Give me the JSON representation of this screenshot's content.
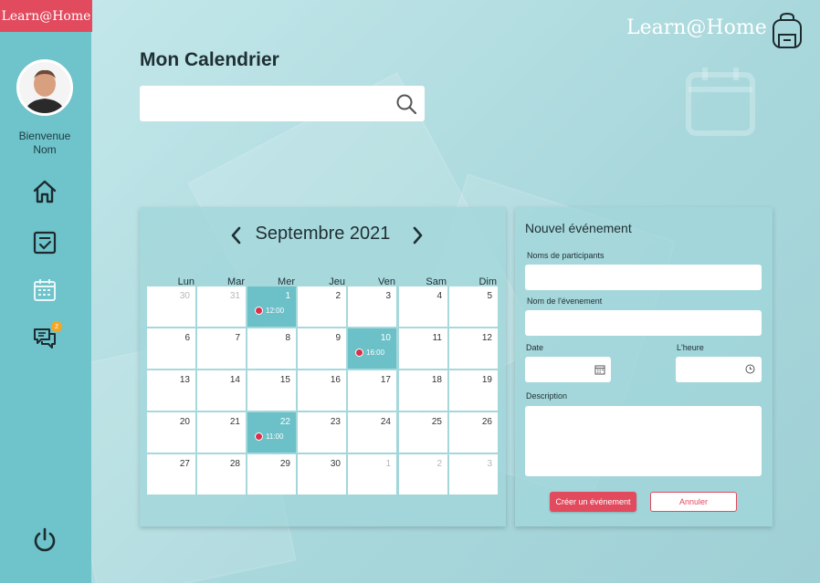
{
  "brand": {
    "badge_label": "Learn@Home",
    "header_logo_text": "Learn@Home"
  },
  "sidebar": {
    "welcome_line1": "Bienvenue",
    "welcome_line2": "Nom",
    "items": [
      {
        "icon": "home-icon"
      },
      {
        "icon": "tasks-icon"
      },
      {
        "icon": "calendar-icon",
        "active": true
      },
      {
        "icon": "chat-icon",
        "badge": "2"
      }
    ],
    "logout_icon": "power-icon"
  },
  "page": {
    "title": "Mon Calendrier",
    "search": {
      "value": "",
      "placeholder": ""
    }
  },
  "calendar": {
    "month_label": "Septembre 2021",
    "weekdays": [
      "Lun",
      "Mar",
      "Mer",
      "Jeu",
      "Ven",
      "Sam",
      "Dim"
    ],
    "weeks": [
      [
        {
          "d": "30",
          "m": true
        },
        {
          "d": "31",
          "m": true
        },
        {
          "d": "1",
          "e": "12:00"
        },
        {
          "d": "2"
        },
        {
          "d": "3"
        },
        {
          "d": "4"
        },
        {
          "d": "5"
        }
      ],
      [
        {
          "d": "6"
        },
        {
          "d": "7"
        },
        {
          "d": "8"
        },
        {
          "d": "9"
        },
        {
          "d": "10",
          "e": "16:00"
        },
        {
          "d": "11"
        },
        {
          "d": "12"
        }
      ],
      [
        {
          "d": "13"
        },
        {
          "d": "14"
        },
        {
          "d": "15"
        },
        {
          "d": "16"
        },
        {
          "d": "17"
        },
        {
          "d": "18"
        },
        {
          "d": "19"
        }
      ],
      [
        {
          "d": "20"
        },
        {
          "d": "21"
        },
        {
          "d": "22",
          "e": "11:00"
        },
        {
          "d": "23"
        },
        {
          "d": "24"
        },
        {
          "d": "25"
        },
        {
          "d": "26"
        }
      ],
      [
        {
          "d": "27"
        },
        {
          "d": "28"
        },
        {
          "d": "29"
        },
        {
          "d": "30"
        },
        {
          "d": "1",
          "m": true
        },
        {
          "d": "2",
          "m": true
        },
        {
          "d": "3",
          "m": true
        }
      ]
    ]
  },
  "form": {
    "title": "Nouvel événement",
    "participants_label": "Noms de participants",
    "participants_value": "",
    "event_name_label": "Nom de l'évenement",
    "event_name_value": "",
    "date_label": "Date",
    "date_value": "",
    "time_label": "L'heure",
    "time_value": "",
    "description_label": "Description",
    "description_value": "",
    "create_label": "Créer un événement",
    "cancel_label": "Annuler"
  },
  "colors": {
    "sidebar": "#6fc3cb",
    "accent": "#e24a5e",
    "event": "#6cc0c8",
    "badge": "#f5a623"
  }
}
